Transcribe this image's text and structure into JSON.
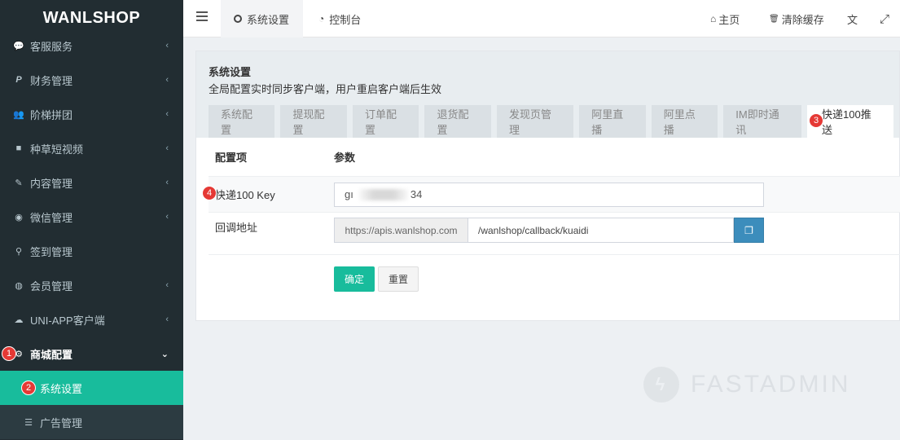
{
  "app": {
    "logo": "WANLSHOP"
  },
  "sidebar": {
    "items": [
      {
        "label": "客服服务",
        "icon": "chat-icon",
        "glyph": "💬"
      },
      {
        "label": "财务管理",
        "icon": "paypal-icon",
        "glyph": "P"
      },
      {
        "label": "阶梯拼团",
        "icon": "users-icon",
        "glyph": "👥"
      },
      {
        "label": "种草短视频",
        "icon": "video-icon",
        "glyph": "■"
      },
      {
        "label": "内容管理",
        "icon": "edit-icon",
        "glyph": "✎"
      },
      {
        "label": "微信管理",
        "icon": "wechat-icon",
        "glyph": "◉"
      },
      {
        "label": "签到管理",
        "icon": "map-marker-icon",
        "glyph": "⚲"
      },
      {
        "label": "会员管理",
        "icon": "user-circle-icon",
        "glyph": "◍"
      },
      {
        "label": "UNI-APP客户端",
        "icon": "cloud-icon",
        "glyph": "☁"
      }
    ],
    "active_parent": {
      "label": "商城配置",
      "icon": "gear-icon",
      "glyph": "⚙",
      "badge": "1"
    },
    "sub_items": [
      {
        "label": "系统设置",
        "badge": "2",
        "active": true
      },
      {
        "label": "广告管理",
        "icon": "list-icon",
        "glyph": "☰"
      }
    ]
  },
  "header": {
    "tabs": [
      {
        "label": "系统设置",
        "icon": "circle-icon"
      },
      {
        "label": "控制台",
        "icon": "dashboard-icon",
        "glyph": "◔"
      }
    ],
    "right": {
      "home": "主页",
      "home_glyph": "⌂",
      "clear_cache": "清除缓存",
      "clear_glyph": "🗑",
      "lang_glyph": "文",
      "fullscreen_glyph": "⤢"
    }
  },
  "panel": {
    "title": "系统设置",
    "subtitle": "全局配置实时同步客户端，用户重启客户端后生效",
    "tabs": [
      "系统配置",
      "提现配置",
      "订单配置",
      "退货配置",
      "发现页管理",
      "阿里直播",
      "阿里点播",
      "IM即时通讯",
      "快递100推送"
    ],
    "active_tab_badge": "3",
    "table": {
      "col_item": "配置项",
      "col_param": "参数",
      "key_label": "快递100 Key",
      "key_badge": "4",
      "key_value_start": "gı",
      "key_value_end": "34",
      "callback_label": "回调地址",
      "callback_prefix": "https://apis.wanlshop.com",
      "callback_path": "/wanlshop/callback/kuaidi",
      "copy_glyph": "❐"
    },
    "ok_label": "确定",
    "reset_label": "重置"
  },
  "watermark": {
    "text": "FASTADMIN",
    "glyph": "ϟ"
  }
}
